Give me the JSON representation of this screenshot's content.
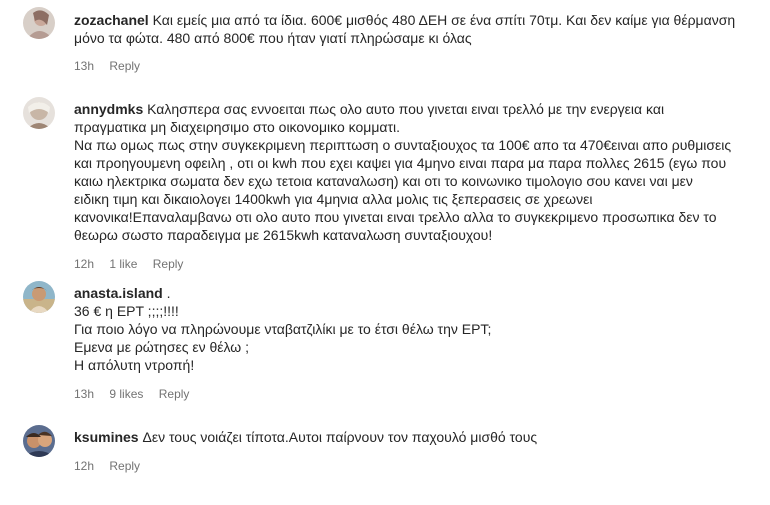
{
  "comments": [
    {
      "username": "zozachanel",
      "lines": [
        " Και εμείς μια από τα ίδια. 600€ μισθός 480 ΔΕΗ σε ένα σπίτι 70τμ. Και δεν καίμε για θέρμανση",
        "μόνο τα φώτα. 480 από 800€ που ήταν γιατί πληρώσαμε κι όλας"
      ],
      "time": "13h",
      "likes": "",
      "reply_label": "Reply"
    },
    {
      "username": "annydmks",
      "lines": [
        " Καλησπερα σας εννοειται πως ολο αυτο που γινεται ειναι τρελλό με την ενεργεια και",
        "πραγματικα μη διαχειρησιμο στο οικονομικο κομματι.",
        "Να πω ομως πως στην συγκεκριμενη περιπτωση ο συνταξιουχος τα 100€ απο τα 470€ειναι απο ρυθμισεις",
        "και προηγουμενη οφειλη , οτι οι kwh που εχει καψει για 4μηνο ειναι παρα μα παρα πολλες 2615 (εγω που",
        "καιω ηλεκτρικα σωματα δεν εχω τετοια καταναλωση) και οτι το κοινωνικο τιμολογιο σου κανει ναι μεν",
        "ειδικη τιμη και δικαιολογει 1400kwh για 4μηνια αλλα μολις τις ξεπερασεις σε χρεωνει",
        "κανονικα!Επαναλαμβανω οτι ολο αυτο που γινεται ειναι τρελλο αλλα το συγκεκριμενο προσωπικα δεν το",
        "θεωρω σωστο παραδειγμα με 2615kwh καταναλωση συνταξιουχου!"
      ],
      "time": "12h",
      "likes": "1 like",
      "reply_label": "Reply"
    },
    {
      "username": "anasta.island",
      "lines": [
        " .",
        "36 € η ΕΡΤ ;;;;!!!!",
        "Για ποιο λόγο να πληρώνουμε νταβατζιλίκι με το έτσι θέλω την ΕΡΤ;",
        "Εμενα με ρώτησες εν θέλω ;",
        "Η απόλυτη ντροπή!"
      ],
      "time": "13h",
      "likes": "9 likes",
      "reply_label": "Reply"
    },
    {
      "username": "ksumines",
      "lines": [
        " Δεν τους νοιάζει τίποτα.Αυτοι παίρνουν τον παχουλό μισθό τους"
      ],
      "time": "12h",
      "likes": "",
      "reply_label": "Reply"
    }
  ],
  "colors": {
    "text": "#262626",
    "meta": "#737373",
    "background": "#ffffff"
  },
  "avatar_icons": [
    "avatar-zozachanel",
    "avatar-annydmks",
    "avatar-anasta-island",
    "avatar-ksumines"
  ]
}
